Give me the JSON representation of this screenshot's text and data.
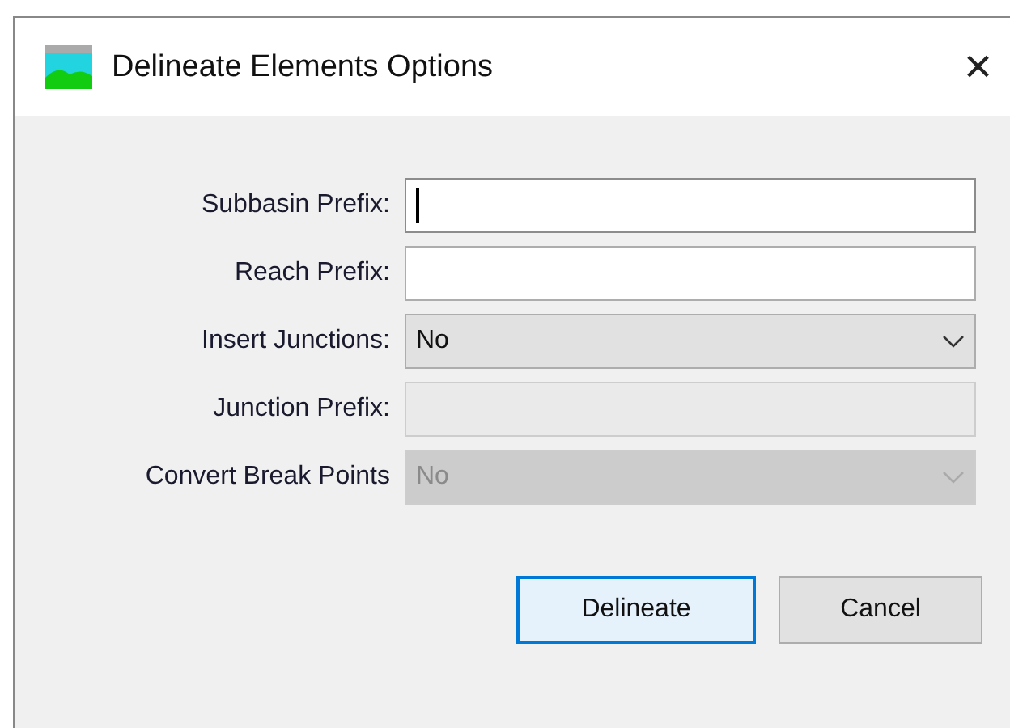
{
  "window": {
    "title": "Delineate Elements Options",
    "close": "×"
  },
  "fields": [
    {
      "label": "Subbasin Prefix:",
      "kind": "text",
      "focused": true,
      "disabled": false
    },
    {
      "label": "Reach Prefix:",
      "kind": "text",
      "focused": false,
      "disabled": false
    },
    {
      "label": "Insert Junctions:",
      "kind": "select",
      "value": "No",
      "focused": false,
      "disabled": false
    },
    {
      "label": "Junction Prefix:",
      "kind": "text",
      "focused": false,
      "disabled": true
    },
    {
      "label": "Convert Break Points",
      "kind": "select",
      "value": "No",
      "focused": false,
      "disabled": true
    }
  ],
  "buttons": [
    {
      "label": "Delineate",
      "default": true
    },
    {
      "label": "Cancel",
      "default": false
    }
  ]
}
